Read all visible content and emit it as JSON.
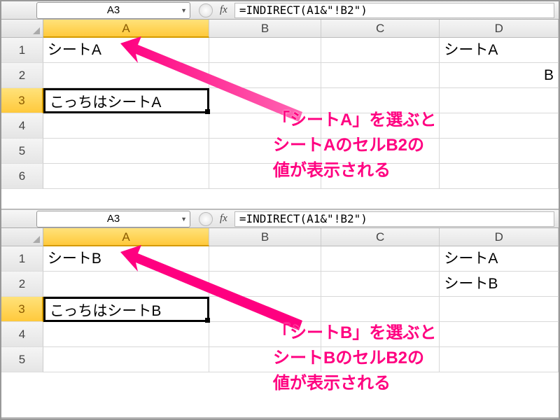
{
  "top": {
    "namebox": "A3",
    "formula": "=INDIRECT(A1&\"!B2\")",
    "cols": [
      "A",
      "B",
      "C",
      "D"
    ],
    "rows": [
      "1",
      "2",
      "3",
      "4",
      "5",
      "6"
    ],
    "cells": {
      "A1": "シートA",
      "A3": "こっちはシートA",
      "D1": "シートA",
      "D2_partial": "B"
    },
    "annotation": "「シートA」を選ぶと\nシートAのセルB2の\n値が表示される"
  },
  "bottom": {
    "namebox": "A3",
    "formula": "=INDIRECT(A1&\"!B2\")",
    "cols": [
      "A",
      "B",
      "C",
      "D"
    ],
    "rows": [
      "1",
      "2",
      "3",
      "4",
      "5"
    ],
    "cells": {
      "A1": "シートB",
      "A3": "こっちはシートB",
      "D1": "シートA",
      "D2": "シートB"
    },
    "annotation": "「シートB」を選ぶと\nシートBのセルB2の\n値が表示される"
  },
  "fx_label": "fx"
}
